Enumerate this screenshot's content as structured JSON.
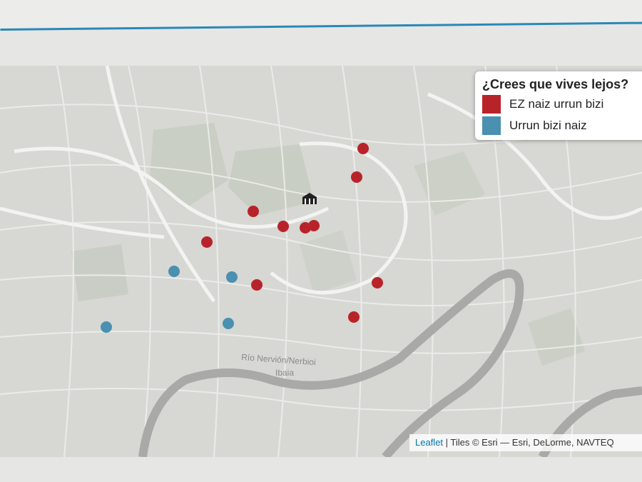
{
  "legend": {
    "title": "¿Crees que vives lejos?",
    "items": [
      {
        "label": "EZ naiz urrun bizi",
        "color": "#b8232a"
      },
      {
        "label": "Urrun bizi naiz",
        "color": "#4a90b0"
      }
    ]
  },
  "map": {
    "river_label_line1": "Río Nervión/Nerbioi",
    "river_label_line2": "Ibaia",
    "center_icon": "museum-icon"
  },
  "markers": [
    {
      "category": "EZ naiz urrun bizi"
    },
    {
      "category": "EZ naiz urrun bizi"
    },
    {
      "category": "EZ naiz urrun bizi"
    },
    {
      "category": "EZ naiz urrun bizi"
    },
    {
      "category": "EZ naiz urrun bizi"
    },
    {
      "category": "EZ naiz urrun bizi"
    },
    {
      "category": "EZ naiz urrun bizi"
    },
    {
      "category": "EZ naiz urrun bizi"
    },
    {
      "category": "EZ naiz urrun bizi"
    },
    {
      "category": "EZ naiz urrun bizi"
    },
    {
      "category": "Urrun bizi naiz"
    },
    {
      "category": "Urrun bizi naiz"
    },
    {
      "category": "Urrun bizi naiz"
    },
    {
      "category": "Urrun bizi naiz"
    }
  ],
  "attribution": {
    "link": "Leaflet",
    "text": " | Tiles © Esri — Esri, DeLorme, NAVTEQ"
  }
}
